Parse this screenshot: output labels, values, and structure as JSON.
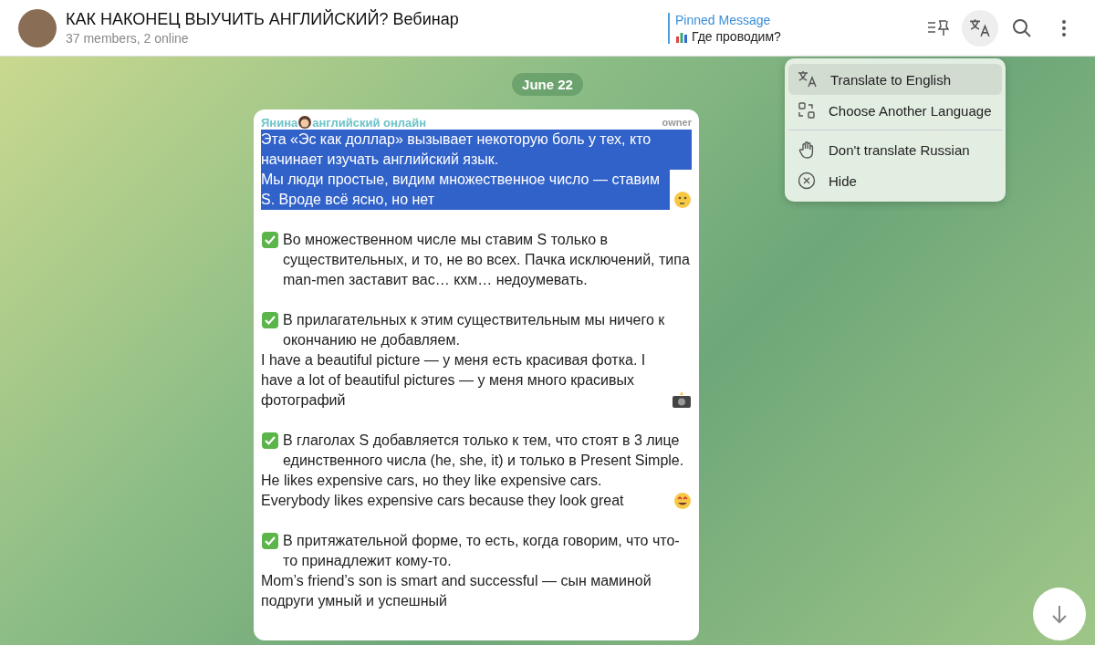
{
  "header": {
    "title": "КАК НАКОНЕЦ ВЫУЧИТЬ АНГЛИЙСКИЙ? Вебинар",
    "subtitle": "37 members, 2 online"
  },
  "pinned": {
    "label": "Pinned Message",
    "text": "Где проводим?"
  },
  "toolbar": {
    "translate_active": true
  },
  "date": "June 22",
  "message": {
    "sender_before_icon": "Янина",
    "sender_after_icon": "английский онлайн",
    "role": "owner",
    "blocks": [
      {
        "kind": "plain",
        "selected": true,
        "lines": [
          "Эта «Эс как доллар» вызывает некоторую боль у тех, кто начинает изучать английский язык.",
          "Мы люди простые, видим множественное число — ставим S. Вроде всё ясно, но нет"
        ]
      },
      {
        "kind": "check",
        "selected": false,
        "lines": [
          "Во множественном числе мы ставим S только в существительных, и то, не во всех. Пачка исключений, типа man-men заставит вас… кхм… недоумевать."
        ]
      },
      {
        "kind": "check",
        "selected": false,
        "lines": [
          "В прилагательных к этим существительным мы ничего к окончанию не добавляем.",
          "I have a beautiful picture — у меня есть красивая фотка. I have a lot of beautiful pictures — у меня много красивых фотографий"
        ]
      },
      {
        "kind": "check",
        "selected": false,
        "lines": [
          "В глаголах S добавляется только к тем, что стоят в 3 лице единственного числа (he, she, it) и только в Present Simple.",
          "He likes expensive cars, но they like expensive cars. Everybody likes expensive cars because they look great"
        ]
      },
      {
        "kind": "check",
        "selected": false,
        "lines": [
          "В притяжательной форме, то есть, когда говорим, что что-то принадлежит кому-то.",
          "Mom’s friend’s son is smart and successful — сын маминой подруги умный и успешный"
        ]
      }
    ]
  },
  "menu": {
    "items": [
      {
        "label": "Translate to English",
        "selected": true
      },
      {
        "label": "Choose Another Language",
        "selected": false
      },
      {
        "label": "Don't translate Russian",
        "selected": false
      },
      {
        "label": "Hide",
        "selected": false
      }
    ]
  }
}
